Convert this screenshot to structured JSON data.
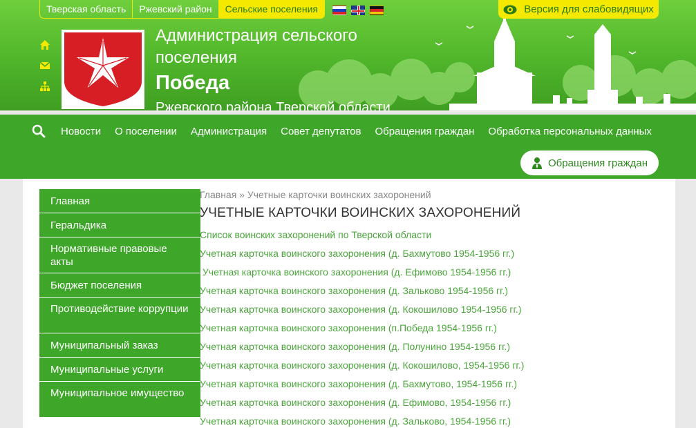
{
  "top_bar": {
    "regions": [
      "Тверская область",
      "Ржевский район",
      "Сельские поселения"
    ],
    "vision_label": "Версия для слабовидящих"
  },
  "header": {
    "title_line1": "Администрация сельского",
    "title_line2": "поселения",
    "name": "Победа",
    "subtitle": "Ржевского района Тверской области"
  },
  "nav": {
    "items": [
      "Новости",
      "О поселении",
      "Администрация",
      "Совет депутатов",
      "Обращения граждан",
      "Обработка персональных данных"
    ],
    "appeal_button": "Обращения граждан"
  },
  "sidebar": {
    "items": [
      "Главная",
      "Геральдика",
      "Нормативные правовые акты",
      "Бюджет поселения",
      "Противодействие коррупции",
      "Муниципальный заказ",
      "Муниципальные услуги",
      "Муниципальное имущество"
    ]
  },
  "main": {
    "breadcrumb": "Главная » Учетные карточки воинских захоронений",
    "title": "УЧЕТНЫЕ КАРТОЧКИ ВОИНСКИХ ЗАХОРОНЕНИЙ",
    "links": [
      "Список воинских захоронений по Тверской области",
      "Учетная карточка воинского захоронения (д. Бахмутово 1954-1956 гг.)",
      " Учетная карточка воинского захоронения (д. Ефимово 1954-1956 гг.)",
      "Учетная карточка воинского захоронения (д. Зальково 1954-1956 гг.)",
      "Учетная карточка воинского захоронения (д. Кокошилово 1954-1956 гг.)",
      "Учетная карточка воинского захоронения (п.Победа 1954-1956 гг.)",
      "Учетная карточка воинского захоронения (д. Полунино 1954-1956 гг.)",
      "Учетная карточка воинского захоронения (д. Кокошилово, 1954-1956 гг.)",
      "Учетная карточка воинского захоронения (д. Бахмутово, 1954-1956 гг.)",
      "Учетная карточка воинского захоронения (д. Ефимово, 1954-1956 гг.)",
      "Учетная карточка воинского захоронения (д. Зальково, 1954-1956 гг.)"
    ]
  },
  "colors": {
    "green": "#3ea72a",
    "light_green": "#6fcf3c",
    "yellow": "#f5e900",
    "link_green": "#4aa53a"
  }
}
